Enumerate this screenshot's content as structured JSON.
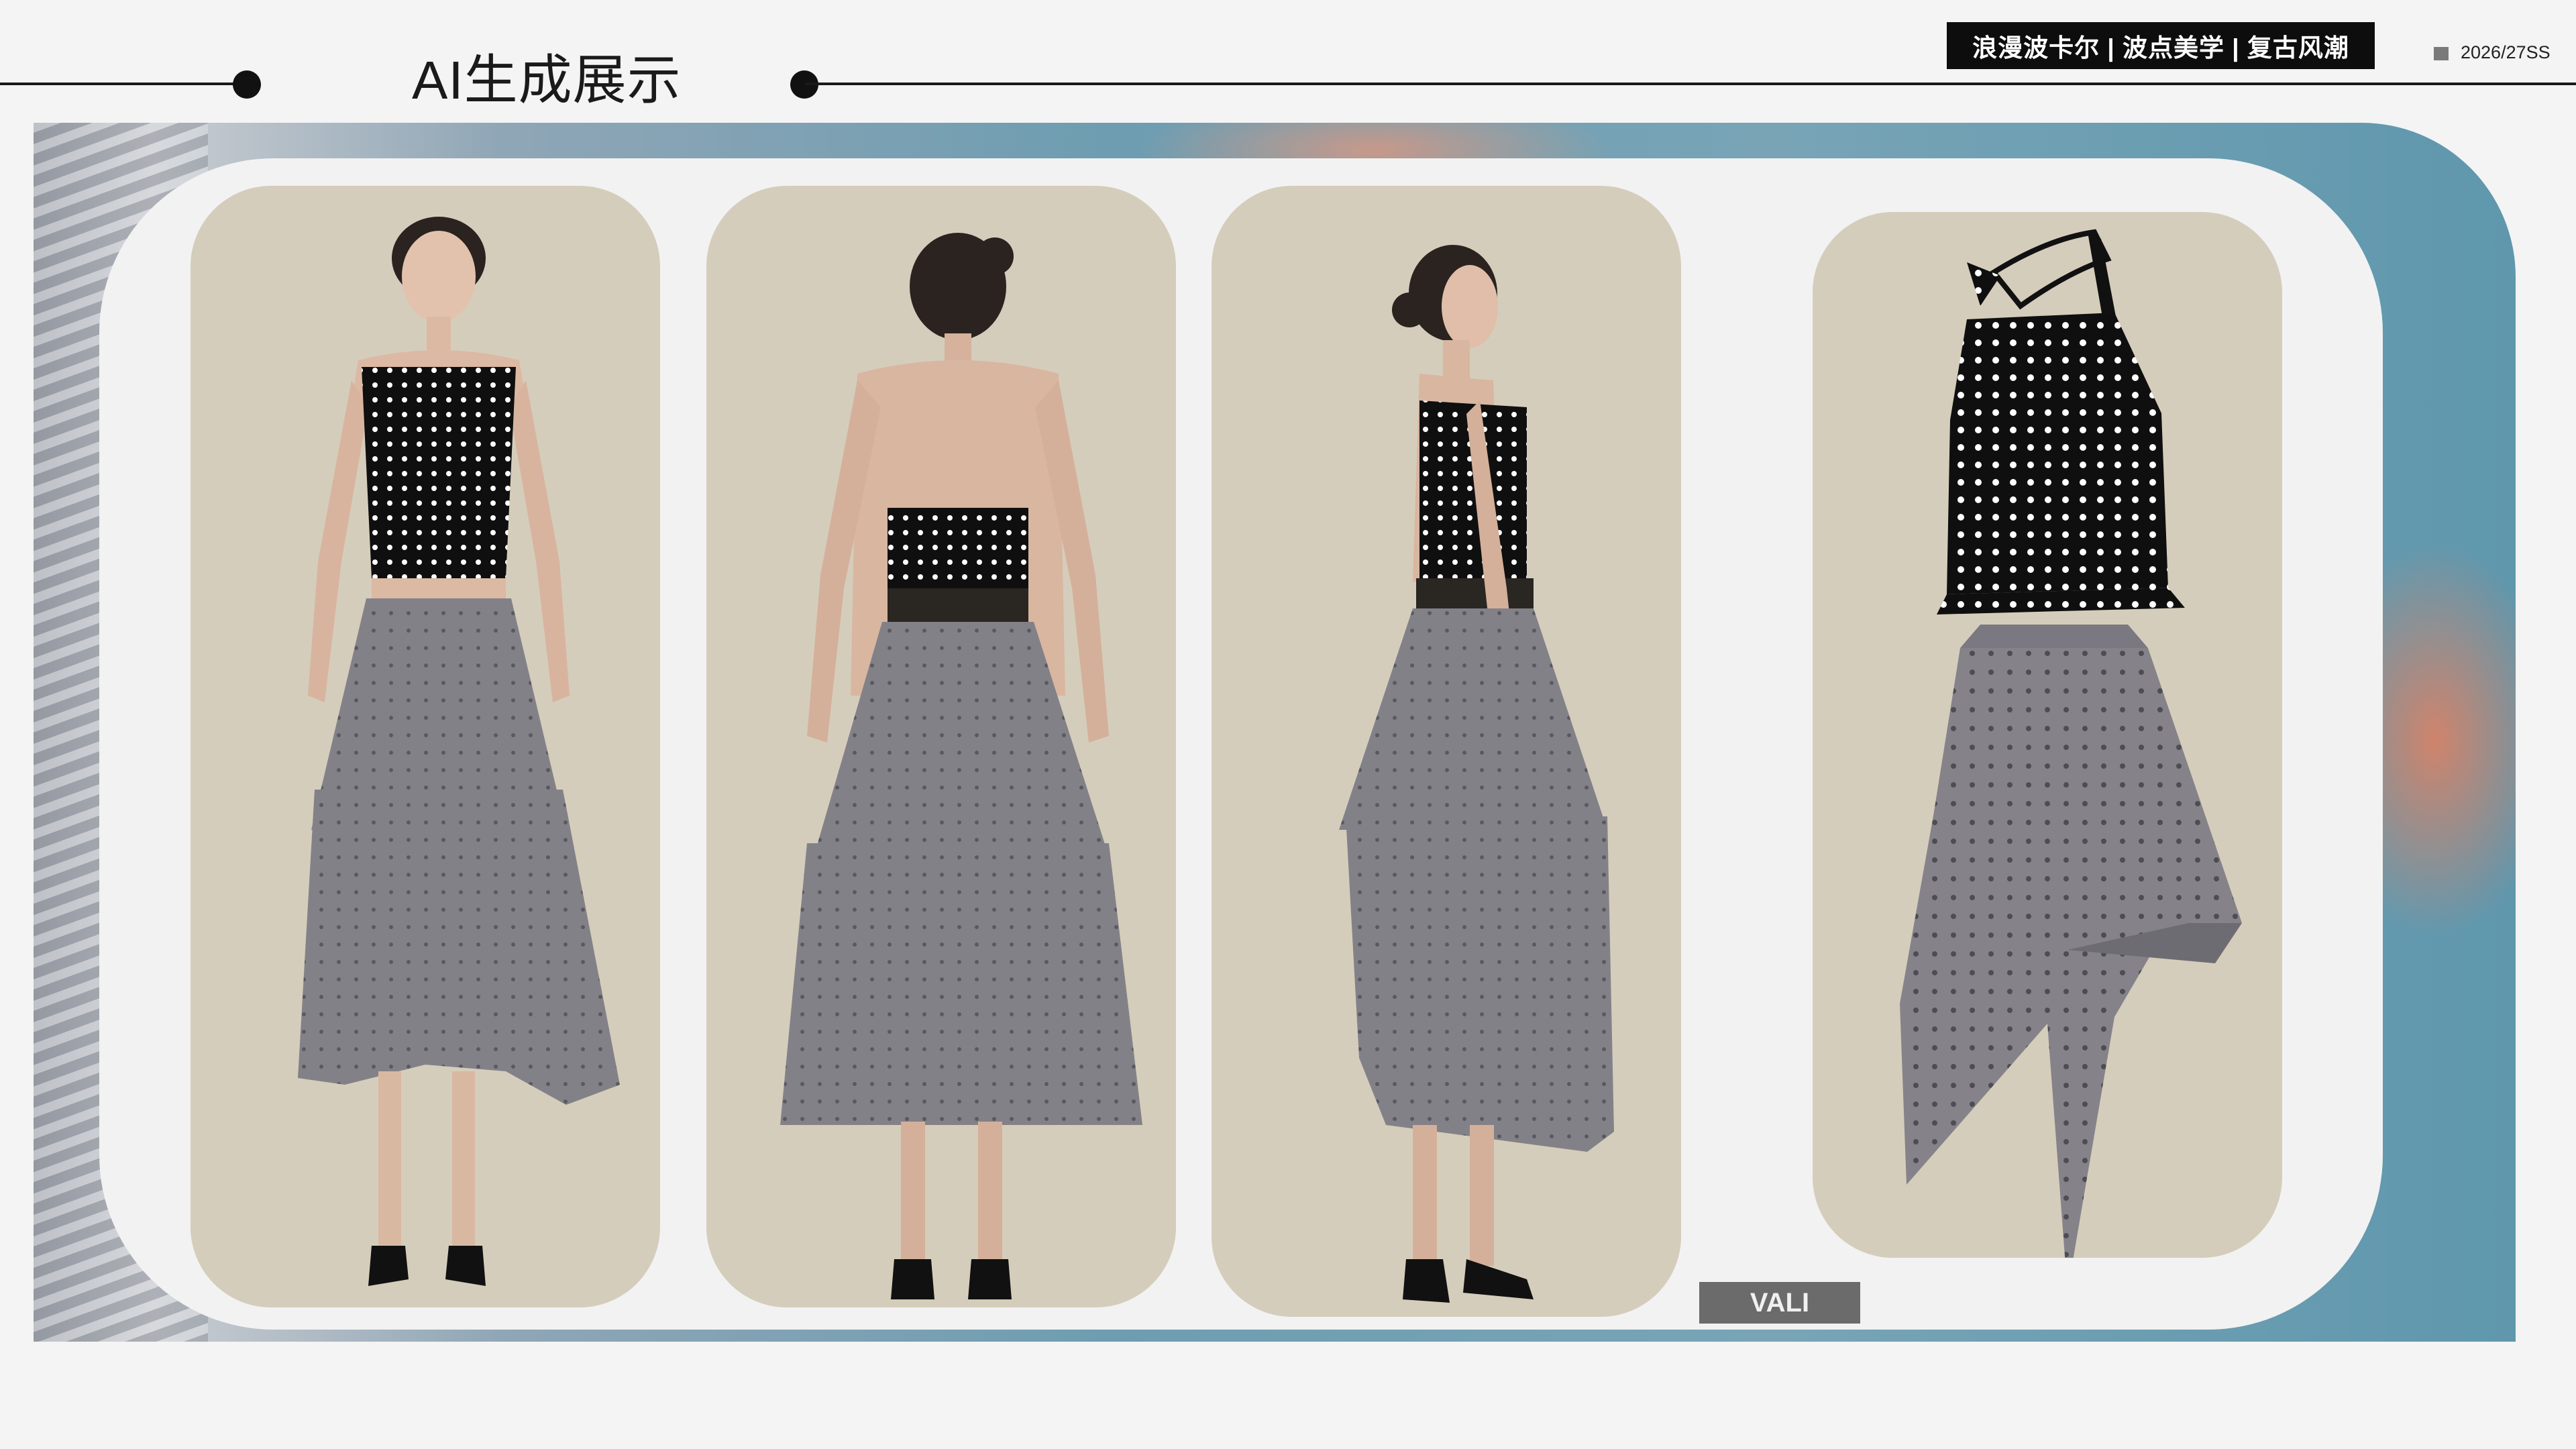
{
  "header": {
    "title": "AI生成展示",
    "tagline": "浪漫波卡尔 | 波点美学 | 复古风潮",
    "season": "2026/27SS"
  },
  "gallery": {
    "views": [
      "front-view",
      "back-view",
      "side-view",
      "flat-product-view"
    ],
    "label": "VALI"
  },
  "colors": {
    "card": "#d5cdbb",
    "skirt": "#828087",
    "top": "#0f0f0f",
    "dots": "#ffffff",
    "accent": "#0d0d0d"
  },
  "icons": [
    "season-square-icon",
    "timeline-dot-icon"
  ]
}
